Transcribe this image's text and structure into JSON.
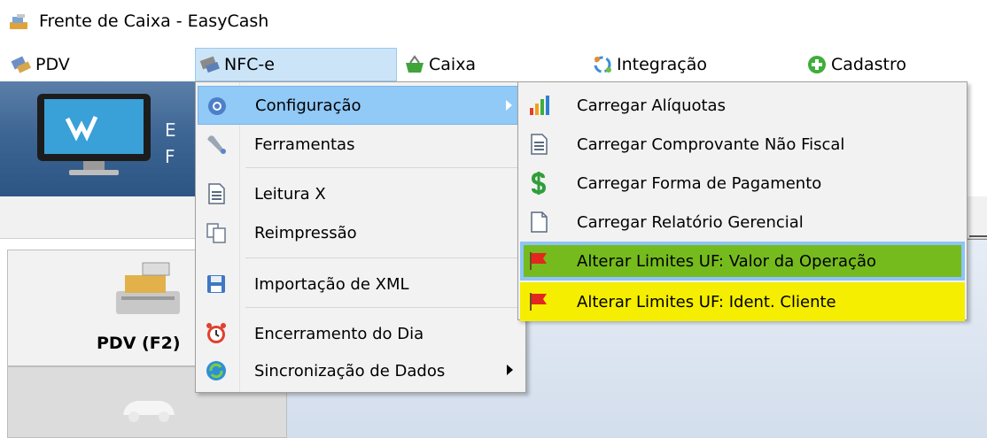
{
  "window": {
    "title": "Frente de Caixa - EasyCash",
    "icon": "cash-register-icon"
  },
  "menubar": {
    "items": [
      {
        "label": "PDV",
        "icon": "pdv-icon"
      },
      {
        "label": "NFC-e",
        "icon": "nfce-icon"
      },
      {
        "label": "Caixa",
        "icon": "basket-icon"
      },
      {
        "label": "Integração",
        "icon": "sync-icon"
      },
      {
        "label": "Cadastro",
        "icon": "plus-circle-icon"
      }
    ]
  },
  "background": {
    "banner_letters": [
      "E",
      "F"
    ],
    "pdv_button_label": "PDV (F2)"
  },
  "nfce_menu": {
    "items": [
      {
        "label": "Configuração",
        "icon": "gear-icon",
        "has_submenu": true,
        "highlighted": true
      },
      {
        "label": "Ferramentas",
        "icon": "wrench-icon"
      },
      {
        "label": "Leitura X",
        "icon": "document-icon"
      },
      {
        "label": "Reimpressão",
        "icon": "copy-icon"
      },
      {
        "label": "Importação de XML",
        "icon": "save-icon"
      },
      {
        "label": "Encerramento do Dia",
        "icon": "alarm-clock-icon"
      },
      {
        "label": "Sincronização de Dados",
        "icon": "refresh-icon",
        "has_submenu": true
      }
    ]
  },
  "config_submenu": {
    "items": [
      {
        "label": "Carregar Alíquotas",
        "icon": "bar-chart-icon"
      },
      {
        "label": "Carregar Comprovante Não Fiscal",
        "icon": "receipt-icon"
      },
      {
        "label": "Carregar Forma de Pagamento",
        "icon": "dollar-icon"
      },
      {
        "label": "Carregar Relatório Gerencial",
        "icon": "blank-document-icon"
      },
      {
        "label": "Alterar Limites UF: Valor da Operação",
        "icon": "flag-icon",
        "highlight_color": "#76bb1e"
      },
      {
        "label": "Alterar Limites UF: Ident. Cliente",
        "icon": "flag-icon",
        "highlight_color": "#f5ee00"
      }
    ]
  },
  "colors": {
    "menu_hover": "#91c9f7",
    "menubar_active": "#cce4f7",
    "banner_blue": "#3e6694"
  }
}
